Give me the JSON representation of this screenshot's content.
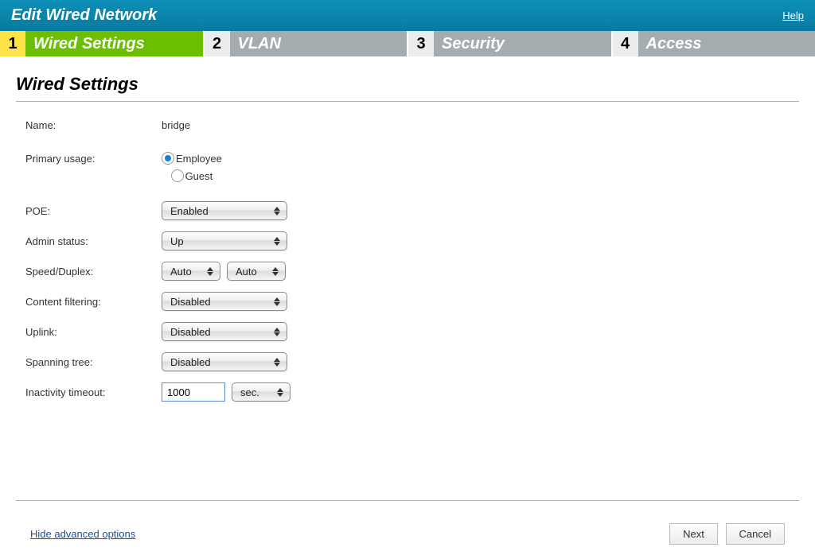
{
  "header": {
    "title": "Edit Wired Network",
    "help": "Help"
  },
  "steps": [
    {
      "num": "1",
      "label": "Wired Settings",
      "active": true
    },
    {
      "num": "2",
      "label": "VLAN",
      "active": false
    },
    {
      "num": "3",
      "label": "Security",
      "active": false
    },
    {
      "num": "4",
      "label": "Access",
      "active": false
    }
  ],
  "section_title": "Wired Settings",
  "fields": {
    "name": {
      "label": "Name:",
      "value": "bridge"
    },
    "primary_usage": {
      "label": "Primary usage:",
      "options": [
        "Employee",
        "Guest"
      ],
      "selected": "Employee"
    },
    "poe": {
      "label": "POE:",
      "value": "Enabled"
    },
    "admin_status": {
      "label": "Admin status:",
      "value": "Up"
    },
    "speed_duplex": {
      "label": "Speed/Duplex:",
      "speed": "Auto",
      "duplex": "Auto"
    },
    "content_filtering": {
      "label": "Content filtering:",
      "value": "Disabled"
    },
    "uplink": {
      "label": "Uplink:",
      "value": "Disabled"
    },
    "spanning_tree": {
      "label": "Spanning tree:",
      "value": "Disabled"
    },
    "inactivity_timeout": {
      "label": "Inactivity timeout:",
      "value": "1000",
      "unit": "sec."
    }
  },
  "footer": {
    "advanced_link": "Hide advanced options",
    "next": "Next",
    "cancel": "Cancel"
  }
}
